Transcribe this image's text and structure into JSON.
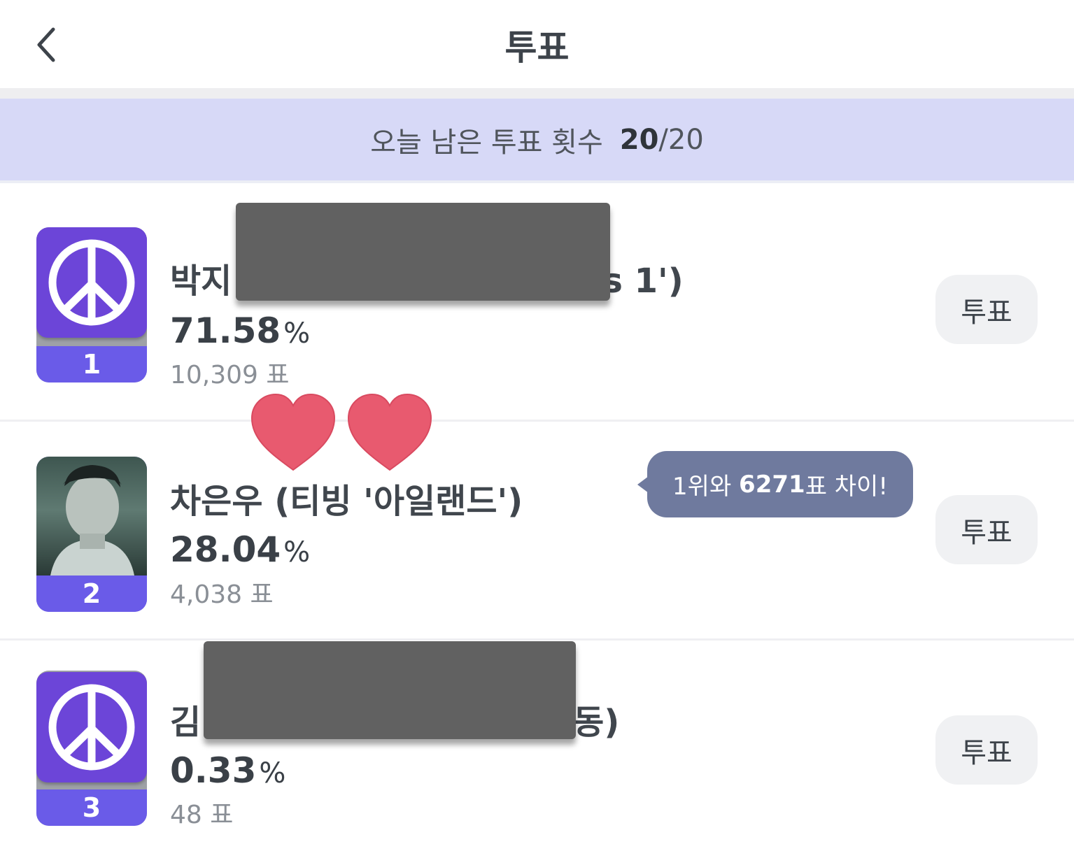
{
  "header": {
    "title": "투표",
    "back_icon": "chevron-left-icon"
  },
  "banner": {
    "label": "오늘 남은 투표 횟수",
    "remaining": "20",
    "total": "/20",
    "background": "#d7d9f7"
  },
  "candidates": [
    {
      "rank": "1",
      "name_visible_start": "박지",
      "name_visible_end": "s 1')",
      "percent": "71.58",
      "percent_sign": "%",
      "votes": "10,309",
      "votes_unit": "표",
      "vote_button": "투표",
      "thumb_icon": "peace-sign-icon"
    },
    {
      "rank": "2",
      "name": "차은우 (티빙 '아일랜드')",
      "percent": "28.04",
      "percent_sign": "%",
      "votes": "4,038",
      "votes_unit": "표",
      "vote_button": "투표",
      "thumb_icon": "person-photo"
    },
    {
      "rank": "3",
      "name_visible_start": "김",
      "name_visible_end": "동)",
      "percent": "0.33",
      "percent_sign": "%",
      "votes": "48",
      "votes_unit": "표",
      "vote_button": "투표",
      "thumb_icon": "peace-sign-icon"
    }
  ],
  "tooltip": {
    "prefix": "1위와 ",
    "diff": "6271",
    "suffix": "표 차이!"
  },
  "colors": {
    "accent": "#6a5be8",
    "tile": "#6c45d8",
    "heart": "#e85a6f",
    "tooltip": "#6f7a9e",
    "redaction": "#616161"
  }
}
